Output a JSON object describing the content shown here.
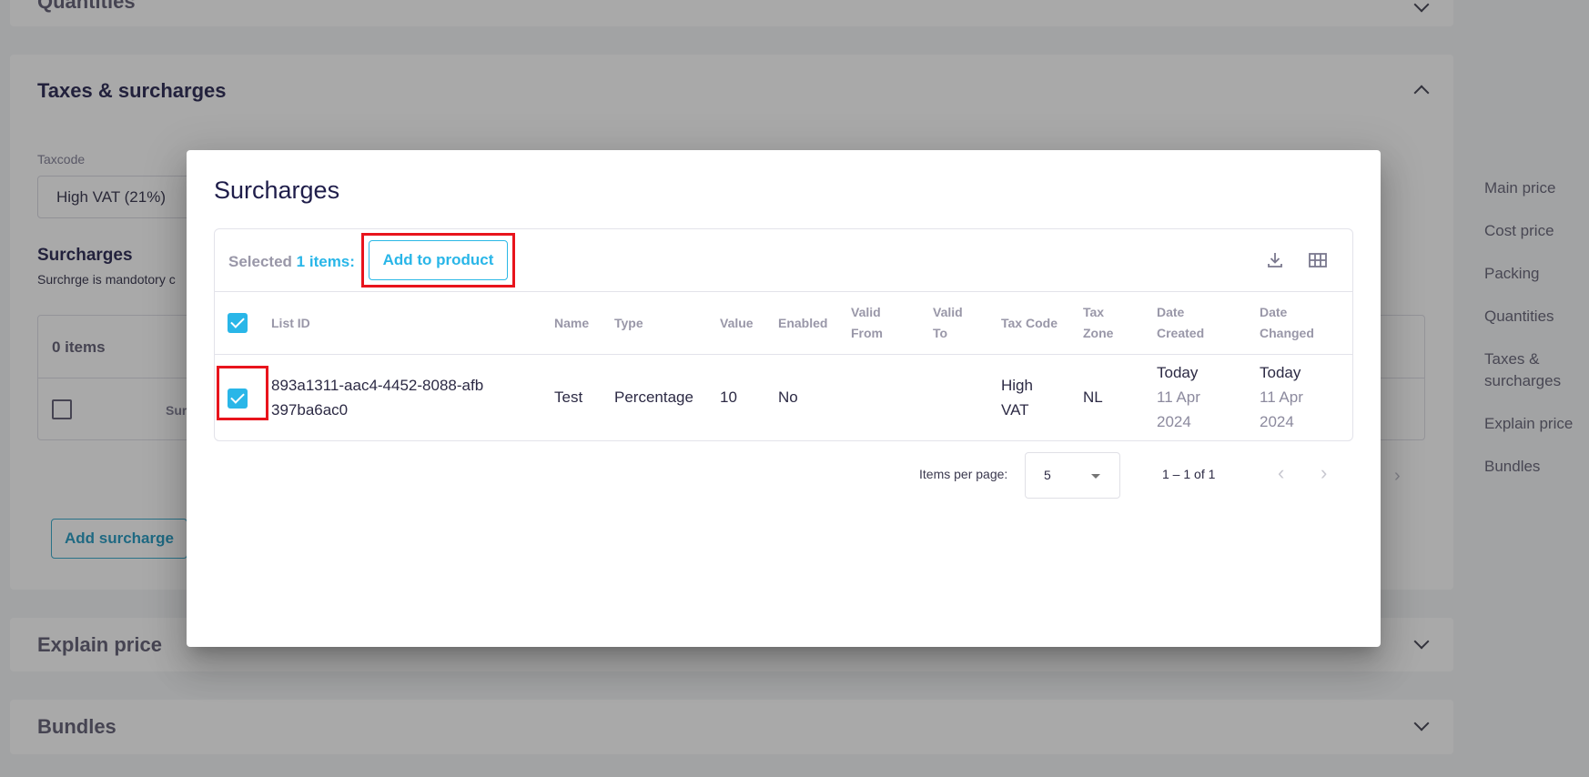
{
  "background": {
    "panels": {
      "quantities": {
        "title": "Quantities"
      },
      "taxes": {
        "title": "Taxes & surcharges",
        "taxcode_label": "Taxcode",
        "taxcode_value": "High VAT (21%)",
        "surcharges_heading": "Surcharges",
        "surcharges_note": "Surchrge is mandotory c",
        "table": {
          "count": "0 items",
          "column_fragment": "Sur"
        },
        "add_surcharge_label": "Add surcharge"
      },
      "explain_price": {
        "title": "Explain price"
      },
      "bundles": {
        "title": "Bundles"
      }
    },
    "side_nav": [
      "Main price",
      "Cost price",
      "Packing",
      "Quantities",
      "Taxes & surcharges",
      "Explain price",
      "Bundles"
    ]
  },
  "modal": {
    "title": "Surcharges",
    "selection": {
      "prefix": "Selected",
      "count": "1 items:",
      "action_label": "Add to product"
    },
    "toolbar_icons": [
      "download-icon",
      "column-grid-icon"
    ],
    "columns": [
      "List ID",
      "Name",
      "Type",
      "Value",
      "Enabled",
      "Valid From",
      "Valid To",
      "Tax Code",
      "Tax Zone",
      "Date Created",
      "Date Changed"
    ],
    "rows": [
      {
        "selected": true,
        "list_id": "893a1311-aac4-4452-8088-afb397ba6ac0",
        "name": "Test",
        "type": "Percentage",
        "value": "10",
        "enabled": "No",
        "valid_from": "",
        "valid_to": "",
        "tax_code": "High VAT",
        "tax_zone": "NL",
        "date_created": {
          "relative": "Today",
          "date": "11 Apr 2024"
        },
        "date_changed": {
          "relative": "Today",
          "date": "11 Apr 2024"
        }
      }
    ],
    "pagination": {
      "items_per_page_label": "Items per page:",
      "items_per_page": "5",
      "range": "1 – 1 of 1"
    }
  },
  "highlight_color": "#e8141c",
  "accent_color": "#29b6e8"
}
